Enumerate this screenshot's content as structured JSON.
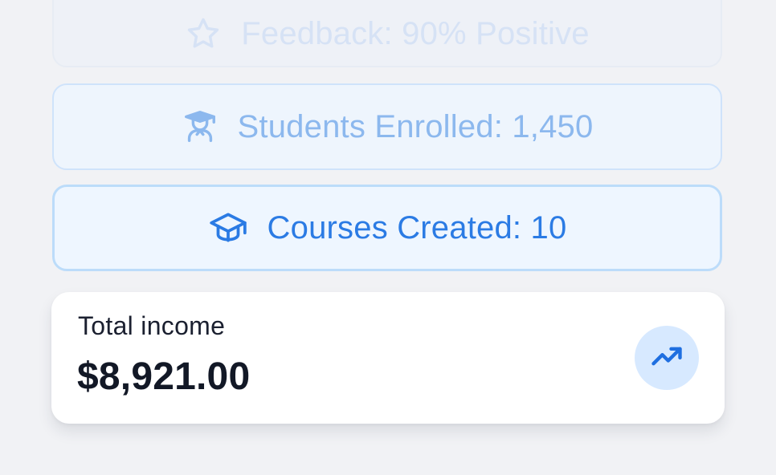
{
  "stats": {
    "feedback": {
      "text": "Feedback: 90% Positive",
      "icon": "star-icon"
    },
    "students": {
      "text": "Students Enrolled: 1,450",
      "icon": "student-icon"
    },
    "courses": {
      "text": "Courses Created: 10",
      "icon": "graduation-cap-icon"
    }
  },
  "income": {
    "label": "Total income",
    "value": "$8,921.00",
    "trend_icon": "trending-up-icon"
  },
  "colors": {
    "background": "#f1f2f5",
    "accent": "#2b7be4",
    "trend_bg": "#d7e9ff"
  }
}
